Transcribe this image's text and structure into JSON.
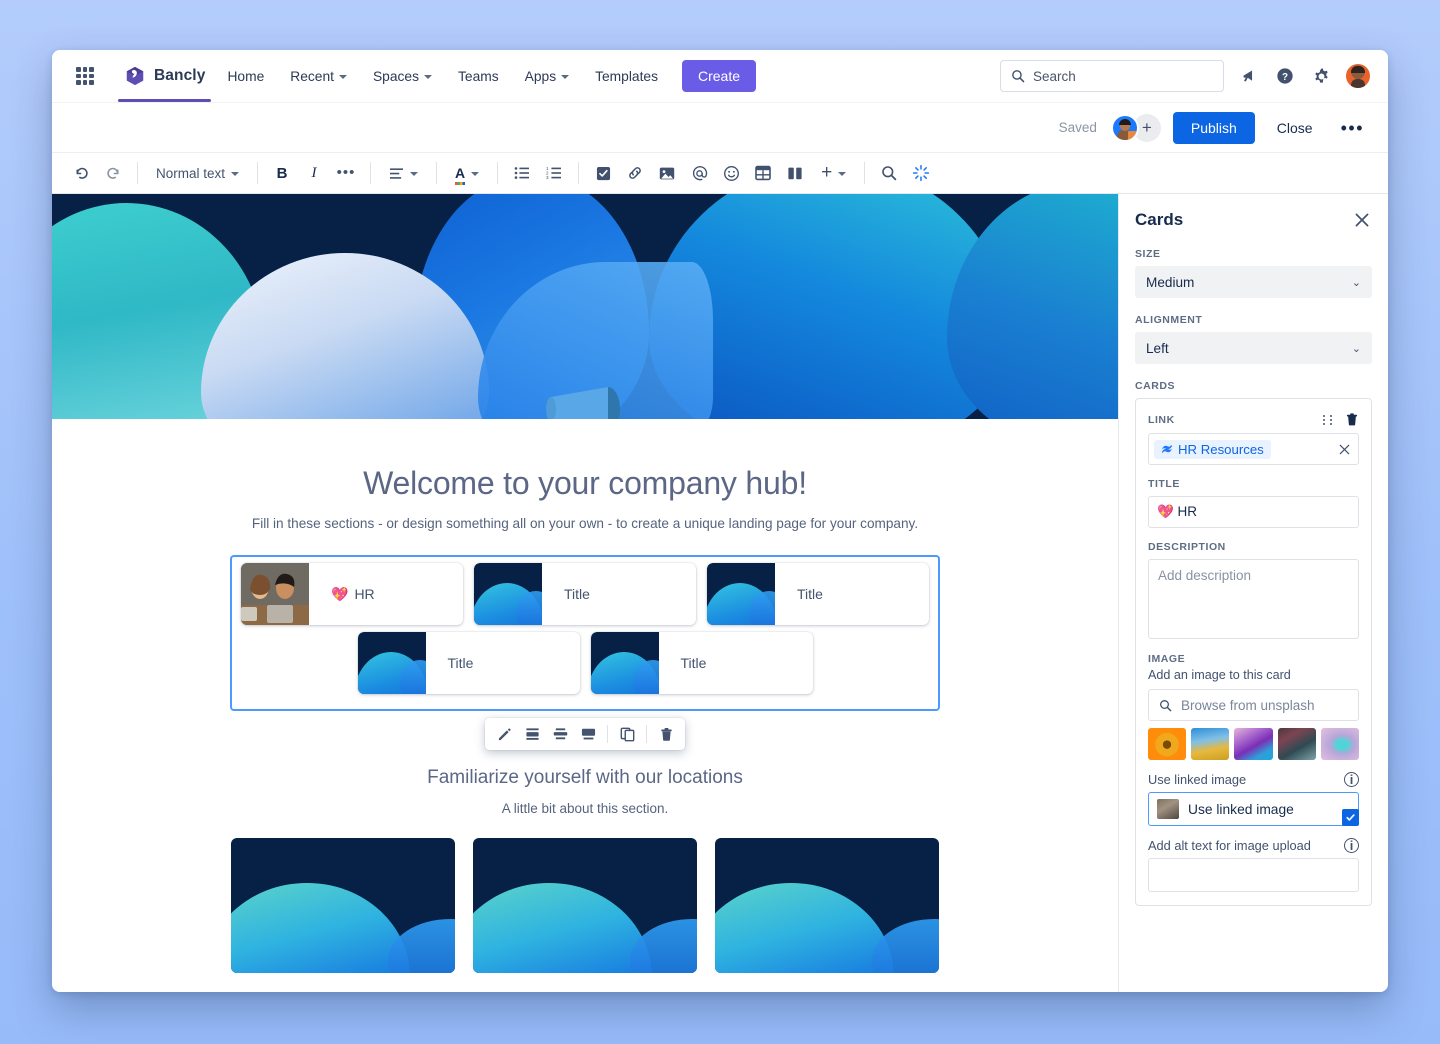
{
  "topnav": {
    "app_grid_icon": "grid-apps-icon",
    "brand": "Bancly",
    "items": [
      {
        "label": "Home",
        "caret": false
      },
      {
        "label": "Recent",
        "caret": true
      },
      {
        "label": "Spaces",
        "caret": true
      },
      {
        "label": "Teams",
        "caret": false
      },
      {
        "label": "Apps",
        "caret": true
      },
      {
        "label": "Templates",
        "caret": false
      }
    ],
    "create_label": "Create",
    "search_placeholder": "Search",
    "icons": [
      "notifications-icon",
      "help-icon",
      "settings-icon",
      "profile-avatar"
    ]
  },
  "editor_header": {
    "saved_label": "Saved",
    "add_people_label": "+",
    "publish_label": "Publish",
    "close_label": "Close",
    "more_label": "•••"
  },
  "toolbar": {
    "undo": "undo-icon",
    "redo": "redo-icon",
    "text_style": "Normal text",
    "bold": "B",
    "italic": "I",
    "more_formatting": "•••",
    "alignment": "align-icon",
    "text_color": "A",
    "bullet_list": "bullet-list-icon",
    "numbered_list": "numbered-list-icon",
    "task_list": "task-checkbox-icon",
    "link": "link-icon",
    "image": "image-icon",
    "mention": "@",
    "emoji": "emoji-icon",
    "table": "table-icon",
    "layout": "layout-columns-icon",
    "insert": "+",
    "find": "search-icon",
    "ai": "ai-sparkle-icon"
  },
  "canvas": {
    "page_title": "Welcome to your company hub!",
    "page_subtitle": "Fill in these sections - or design something all on your own - to create a unique landing page for your company.",
    "hero_icon": "megaphone-icon",
    "cards": [
      {
        "title": "HR",
        "emoji": "💖",
        "thumb": "photo"
      },
      {
        "title": "Title",
        "emoji": "",
        "thumb": "blue"
      },
      {
        "title": "Title",
        "emoji": "",
        "thumb": "blue"
      },
      {
        "title": "Title",
        "emoji": "",
        "thumb": "blue"
      },
      {
        "title": "Title",
        "emoji": "",
        "thumb": "blue"
      }
    ],
    "float_toolbar": [
      "edit-pencil-icon",
      "align-card-left-icon",
      "align-card-center-icon",
      "align-card-wide-icon",
      "copy-icon",
      "delete-icon"
    ],
    "section_title": "Familiarize yourself with our locations",
    "section_subtitle": "A little bit about this section.",
    "image_count": 3
  },
  "panel": {
    "title": "Cards",
    "close_icon": "close-icon",
    "size_label": "SIZE",
    "size_value": "Medium",
    "alignment_label": "ALIGNMENT",
    "alignment_value": "Left",
    "cards_label": "CARDS",
    "card": {
      "link_label": "LINK",
      "drag_icon": "drag-handle-icon",
      "delete_icon": "trash-icon",
      "link_chip": "HR Resources",
      "link_chip_icon": "confluence-page-icon",
      "link_clear_icon": "clear-icon",
      "title_label": "TITLE",
      "title_value": "💖 HR",
      "description_label": "DESCRIPTION",
      "description_placeholder": "Add description",
      "image_label": "IMAGE",
      "image_sublabel": "Add an image to this card",
      "unsplash_placeholder": "Browse from unsplash",
      "unsplash_thumbs": [
        "sunflower",
        "yellow-flowers-sky",
        "purple-gradient",
        "dark-marble",
        "pastel-orb"
      ],
      "use_linked_label": "Use linked image",
      "use_linked_option": "Use linked image",
      "use_linked_checked": true,
      "alt_label": "Add alt text for image upload",
      "alt_value": ""
    }
  },
  "colors": {
    "brand_purple": "#6b5ce7",
    "publish_blue": "#0c66e4",
    "selection_blue": "#4c9aff",
    "text_dark": "#172b4d",
    "text_muted": "#5e6c84"
  }
}
